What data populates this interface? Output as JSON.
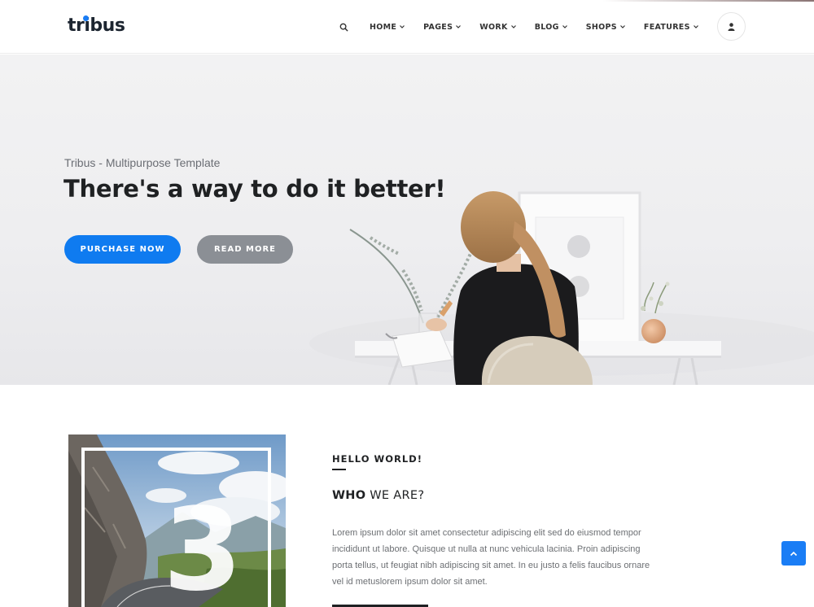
{
  "header": {
    "logo_text": "tribus",
    "nav": [
      {
        "label": "HOME"
      },
      {
        "label": "PAGES"
      },
      {
        "label": "WORK"
      },
      {
        "label": "BLOG"
      },
      {
        "label": "SHOPS"
      },
      {
        "label": "FEATURES"
      }
    ],
    "icons": {
      "search": "search-icon",
      "menu": "hamburger-icon",
      "user": "user-icon"
    }
  },
  "hero": {
    "eyebrow": "Tribus - Multipurpose Template",
    "title": "There's a way to do it better!",
    "primary_button": "PURCHASE NOW",
    "secondary_button": "READ MORE"
  },
  "about": {
    "label": "HELLO WORLD!",
    "heading_bold": "WHO",
    "heading_rest": " WE ARE?",
    "image_numeral": "3",
    "body": "Lorem ipsum dolor sit amet consectetur adipiscing elit sed do eiusmod tempor incididunt ut labore. Quisque ut nulla at nunc vehicula lacinia. Proin adipiscing porta tellus, ut feugiat nibh adipiscing sit amet. In eu justo a felis faucibus ornare vel id metuslorem ipsum dolor sit amet."
  },
  "colors": {
    "accent": "#0f7bf0",
    "secondary_button": "#8b8f95",
    "heading": "#1f2123",
    "body_text": "#6c6f73"
  }
}
